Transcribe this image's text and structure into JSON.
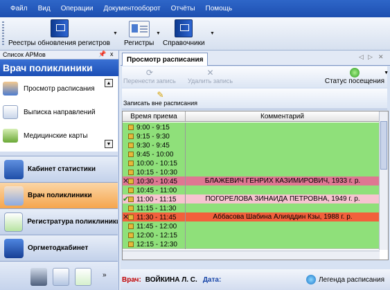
{
  "colors": {
    "menubar": "#1d4fb0",
    "row_free": "#8fe07a",
    "row_blazhevich": "#de7792",
    "row_pogorelova": "#f7c4d0",
    "row_abbasova": "#f2603c"
  },
  "menu": [
    "Файл",
    "Вид",
    "Операции",
    "Документооборот",
    "Отчёты",
    "Помощь"
  ],
  "toolbar": {
    "registers_update": "Реестры обновления регистров",
    "registers": "Регистры",
    "references": "Справочники"
  },
  "left_panel": {
    "header": "Список АРМов",
    "pin_icon": "pin-icon",
    "close_glyph": "x",
    "title": "Врач поликлиники",
    "nav_items": [
      {
        "label": "Просмотр расписания",
        "icon": "doctor-icon"
      },
      {
        "label": "Выписка направлений",
        "icon": "document-icon"
      },
      {
        "label": "Медицинские карты",
        "icon": "cards-icon"
      }
    ],
    "categories": [
      {
        "label": "Кабинет статистики",
        "icon": "statistics-icon"
      },
      {
        "label": "Врач поликлиники",
        "icon": "doctor-icon"
      },
      {
        "label": "Регистратура поликлиники",
        "icon": "checkmark-icon"
      },
      {
        "label": "Оргметодкабинет",
        "icon": "method-icon"
      }
    ]
  },
  "main": {
    "tab": "Просмотр расписания",
    "actions": {
      "move_record": "Перенести запись",
      "delete_record": "Удалить запись",
      "visit_status": "Статус посещения",
      "book_outside": "Записать вне расписания"
    },
    "grid": {
      "col_time": "Время приема",
      "col_comment": "Комментарий",
      "rows": [
        {
          "time": "9:00 - 9:15",
          "comment": "",
          "mark": "",
          "status": "free"
        },
        {
          "time": "9:15 - 9:30",
          "comment": "",
          "mark": "",
          "status": "free"
        },
        {
          "time": "9:30 - 9:45",
          "comment": "",
          "mark": "",
          "status": "free"
        },
        {
          "time": "9:45 - 10:00",
          "comment": "",
          "mark": "",
          "status": "free"
        },
        {
          "time": "10:00 - 10:15",
          "comment": "",
          "mark": "",
          "status": "free"
        },
        {
          "time": "10:15 - 10:30",
          "comment": "",
          "mark": "",
          "status": "free"
        },
        {
          "time": "10:30 - 10:45",
          "comment": "БЛАЖЕВИЧ ГЕНРИХ КАЗИМИРОВИЧ, 1933 г. р.",
          "mark": "✕",
          "status": "blazhevich"
        },
        {
          "time": "10:45 - 11:00",
          "comment": "",
          "mark": "",
          "status": "free"
        },
        {
          "time": "11:00 - 11:15",
          "comment": "ПОГОРЕЛОВА ЗИНАИДА ПЕТРОВНА, 1949 г. р.",
          "mark": "✔",
          "status": "pogorelova"
        },
        {
          "time": "11:15 - 11:30",
          "comment": "",
          "mark": "",
          "status": "free"
        },
        {
          "time": "11:30 - 11:45",
          "comment": "Аббасова Шабина Алияддин Кзы, 1988 г. р.",
          "mark": "✕",
          "status": "abbasova"
        },
        {
          "time": "11:45 - 12:00",
          "comment": "",
          "mark": "",
          "status": "free"
        },
        {
          "time": "12:00 - 12:15",
          "comment": "",
          "mark": "",
          "status": "free"
        },
        {
          "time": "12:15 - 12:30",
          "comment": "",
          "mark": "",
          "status": "free"
        }
      ]
    },
    "footer": {
      "doctor_label": "Врач:",
      "doctor_name": "ВОЙКИНА Л. С.",
      "date_label": "Дата:",
      "legend": "Легенда расписания"
    }
  }
}
